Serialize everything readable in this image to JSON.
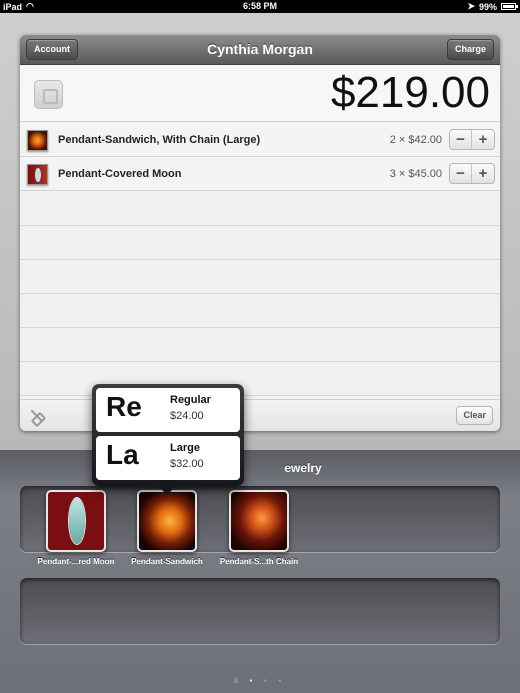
{
  "statusbar": {
    "device": "iPad",
    "time": "6:58 PM",
    "battery": "99%"
  },
  "header": {
    "title": "Cynthia Morgan",
    "account_label": "Account",
    "charge_label": "Charge"
  },
  "order": {
    "total": "$219.00",
    "items": [
      {
        "name": "Pendant-Sandwich, With Chain (Large)",
        "qty_price": "2 × $42.00",
        "thumb_icon": "pendant-sandwich-thumbnail"
      },
      {
        "name": "Pendant-Covered Moon",
        "qty_price": "3 × $45.00",
        "thumb_icon": "pendant-moon-thumbnail"
      }
    ],
    "clear_label": "Clear"
  },
  "category": {
    "title": "Jewelry",
    "visible_title": "ewelry"
  },
  "catalog": [
    {
      "label": "Pendant-...red Moon"
    },
    {
      "label": "Pendant-Sandwich"
    },
    {
      "label": "Pendant-S...th Chain"
    }
  ],
  "popover": {
    "options": [
      {
        "abbr": "Re",
        "name": "Regular",
        "price": "$24.00"
      },
      {
        "abbr": "La",
        "name": "Large",
        "price": "$32.00"
      }
    ]
  },
  "pager": {
    "dollar": "$",
    "dots": "•",
    "active_page": 1,
    "page_count": 3
  },
  "colors": {
    "titlebar": "#595959",
    "bottom_panel": "#6d7077",
    "total_text": "#111111"
  }
}
